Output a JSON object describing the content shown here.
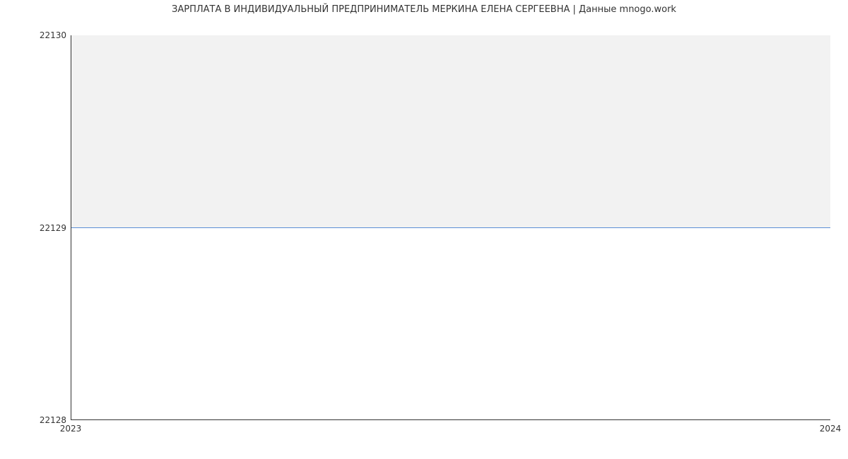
{
  "chart_data": {
    "type": "area",
    "title": "ЗАРПЛАТА В ИНДИВИДУАЛЬНЫЙ ПРЕДПРИНИМАТЕЛЬ МЕРКИНА ЕЛЕНА СЕРГЕЕВНА | Данные mnogo.work",
    "x": [
      2023,
      2024
    ],
    "values": [
      22129,
      22129
    ],
    "xlim": [
      2023,
      2024
    ],
    "ylim": [
      22128,
      22130
    ],
    "xlabel": "",
    "ylabel": "",
    "xticks": [
      2023,
      2024
    ],
    "yticks": [
      22128,
      22129,
      22130
    ],
    "line_color": "#5b8fd6",
    "fill_color": "#f2f2f2"
  },
  "labels": {
    "y_top": "22130",
    "y_mid": "22129",
    "y_bot": "22128",
    "x_left": "2023",
    "x_right": "2024"
  }
}
